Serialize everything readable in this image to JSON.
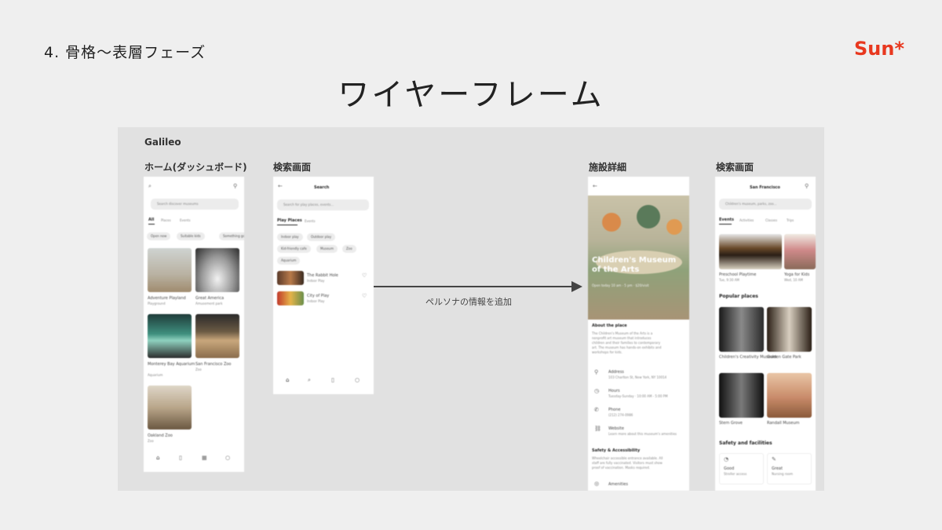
{
  "header": {
    "section_label": "4. 骨格〜表層フェーズ",
    "brand": "Sun*",
    "brand_color": "#e8381f",
    "title": "ワイヤーフレーム"
  },
  "canvas": {
    "project_name": "Galileo",
    "arrow_label": "ペルソナの情報を追加",
    "frames": [
      {
        "label": "ホーム(ダッシュボード)",
        "search_placeholder": "Search discover museums",
        "tabs": [
          "All",
          "Places",
          "Events"
        ],
        "chips": [
          "Open now",
          "Suitable kids",
          "Something good"
        ],
        "cards": [
          {
            "title": "Adventure Playland",
            "sub": "Playground"
          },
          {
            "title": "Great America",
            "sub": "Amusement park"
          },
          {
            "title": "Monterey Bay Aquarium",
            "sub": "Aquarium"
          },
          {
            "title": "San Francisco Zoo",
            "sub": "Zoo"
          },
          {
            "title": "Oakland Zoo",
            "sub": "Zoo"
          }
        ]
      },
      {
        "label": "検索画面",
        "title": "Search",
        "search_placeholder": "Search for play places, events...",
        "tabs": [
          "Play Places",
          "Events"
        ],
        "chips": [
          "Indoor play",
          "Outdoor play",
          "Kid-friendly cafe",
          "Museum",
          "Zoo",
          "Aquarium"
        ],
        "results": [
          {
            "title": "The Rabbit Hole",
            "sub": "Indoor Play"
          },
          {
            "title": "City of Play",
            "sub": "Indoor Play"
          }
        ]
      },
      {
        "label": "施設詳細",
        "hero_title": "Children's Museum of the Arts",
        "hero_sub": "Open today 10 am - 5 pm · $20/visit",
        "about_heading": "About the place",
        "about_text": [
          "The Children's Museum of the Arts is a",
          "nonprofit art museum that introduces",
          "children and their families to contemporary",
          "art. The museum has hands-on exhibits and",
          "workshops for kids."
        ],
        "info": [
          {
            "label": "Address",
            "value": "103 Charlton St, New York, NY 10014"
          },
          {
            "label": "Hours",
            "value": "Tuesday-Sunday · 10:00 AM - 5:00 PM"
          },
          {
            "label": "Phone",
            "value": "(212) 274-0986"
          },
          {
            "label": "Website",
            "value": "Learn more about this museum's amenities"
          }
        ],
        "safety_heading": "Safety & Accessibility",
        "safety_text": [
          "Wheelchair accessible entrance available. All",
          "staff are fully vaccinated. Visitors must show",
          "proof of vaccination. Masks required."
        ],
        "amenities": "Amenities"
      },
      {
        "label": "検索画面",
        "title": "San Francisco",
        "search_placeholder": "Children's museum, parks, zoo...",
        "tabs": [
          "Events",
          "Activities",
          "Classes",
          "Trips"
        ],
        "events": [
          {
            "title": "Preschool Playtime",
            "sub": "Tue, 9:30 AM"
          },
          {
            "title": "Yoga for Kids",
            "sub": "Wed, 10 AM"
          }
        ],
        "popular_heading": "Popular places",
        "places": [
          {
            "title": "Children's Creativity Museum"
          },
          {
            "title": "Golden Gate Park"
          },
          {
            "title": "Stern Grove"
          },
          {
            "title": "Randall Museum"
          }
        ],
        "safety_heading": "Safety and facilities",
        "safety_items": [
          {
            "title": "Good",
            "sub": "Stroller access"
          },
          {
            "title": "Great",
            "sub": "Nursing room"
          }
        ]
      }
    ]
  }
}
